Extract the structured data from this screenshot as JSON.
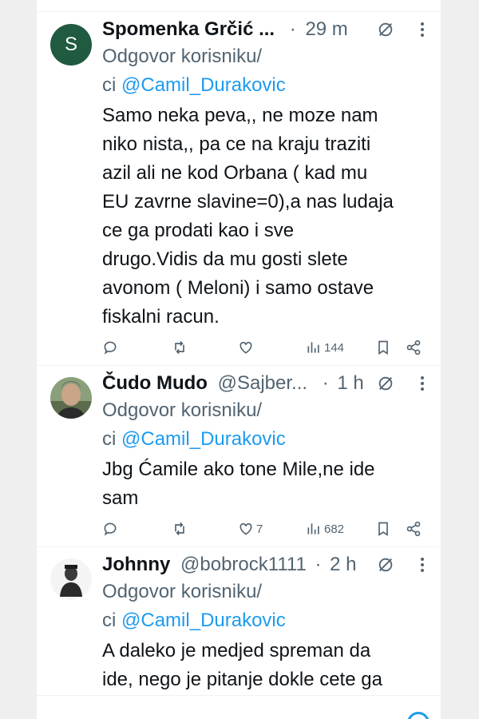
{
  "replies": [
    {
      "author_name": "Spomenka Grčić ...",
      "handle": "",
      "separator": "·",
      "time": "29 m",
      "avatar_letter": "S",
      "reply_prefix": "Odgovor korisniku/",
      "reply_prefix_2": "ci",
      "reply_to": "@Camil_Durakovic",
      "text_lines": [
        "Samo neka peva,, ne moze nam",
        "niko nista,, pa ce na kraju traziti",
        "azil ali ne kod Orbana ( kad mu",
        "EU zavrne slavine=0),a nas ludaja",
        "ce ga prodati kao i sve",
        "drugo.Vidis da mu gosti slete",
        "avonom ( Meloni) i samo ostave",
        "fiskalni racun."
      ],
      "likes": "",
      "views": "144"
    },
    {
      "author_name": "Čudo Mudo",
      "handle": "@Sajber...",
      "separator": "·",
      "time": "1 h",
      "avatar_letter": "",
      "reply_prefix": "Odgovor korisniku/",
      "reply_prefix_2": "ci",
      "reply_to": "@Camil_Durakovic",
      "text_lines": [
        "Jbg Ćamile ako tone Mile,ne ide",
        "sam"
      ],
      "likes": "7",
      "views": "682"
    },
    {
      "author_name": "Johnny",
      "handle": "@bobrock1111",
      "separator": "·",
      "time": "2 h",
      "avatar_letter": "",
      "reply_prefix": "Odgovor korisniku/",
      "reply_prefix_2": "ci",
      "reply_to": "@Camil_Durakovic",
      "text_lines": [
        "A daleko je medjed spreman da",
        "ide, nego je pitanje dokle cete ga"
      ],
      "likes": "",
      "views": ""
    }
  ],
  "icons": {
    "reply": "reply-icon",
    "repost": "repost-icon",
    "like": "heart-icon",
    "views": "views-icon",
    "bookmark": "bookmark-icon",
    "share": "share-icon",
    "grok": "grok-icon",
    "more": "more-icon"
  },
  "colors": {
    "accent": "#1d9bf0",
    "text": "#0f1419",
    "muted": "#536471",
    "avatar_bg": "#1f5a41"
  }
}
